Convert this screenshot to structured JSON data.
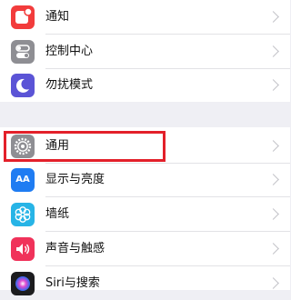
{
  "settings": {
    "group1": [
      {
        "label": "通知",
        "icon": "notifications-icon",
        "color": "#f23c3c"
      },
      {
        "label": "控制中心",
        "icon": "control-center-icon",
        "color": "#8e8e93"
      },
      {
        "label": "勿扰模式",
        "icon": "moon-icon",
        "color": "#5b54d6"
      }
    ],
    "group2": [
      {
        "label": "通用",
        "icon": "gear-icon",
        "color": "#8e8e93"
      },
      {
        "label": "显示与亮度",
        "icon": "display-brightness-icon",
        "color": "#1f7cf2",
        "icon_text": "AA"
      },
      {
        "label": "墙纸",
        "icon": "wallpaper-icon",
        "color": "#27b4e6"
      },
      {
        "label": "声音与触感",
        "icon": "sounds-icon",
        "color": "#f0325a"
      },
      {
        "label": "Siri与搜索",
        "icon": "siri-icon",
        "color": "#1c1c1e"
      }
    ]
  },
  "highlight_color": "#e3202a"
}
